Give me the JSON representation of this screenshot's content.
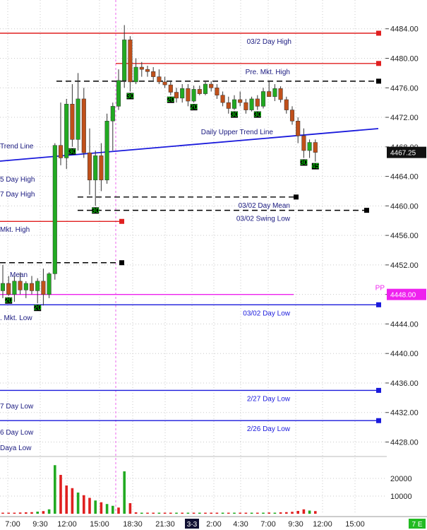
{
  "chart_data": {
    "type": "candlestick",
    "price_axis": {
      "ticks": [
        4484,
        4480,
        4476,
        4472,
        4468,
        4464,
        4460,
        4456,
        4452,
        4448,
        4444,
        4440,
        4436,
        4432,
        4428
      ],
      "tick_labels": [
        "4484.00",
        "4480.00",
        "4476.00",
        "4472.00",
        "4468.00",
        "4464.00",
        "4460.00",
        "4456.00",
        "4452.00",
        "4448.00",
        "4444.00",
        "4440.00",
        "4436.00",
        "4432.00",
        "4428.00"
      ],
      "ylim": [
        4426.9,
        4487.9
      ],
      "last_price_label": "4467.25",
      "last_price": 4467.25,
      "pivot_price_label": "4448.00",
      "pivot_price": 4448.0
    },
    "volume_axis": {
      "ticks": [
        20000,
        10000
      ],
      "tick_labels": [
        "20000",
        "10000"
      ]
    },
    "time_axis": {
      "labels": [
        "7:00",
        "9:30",
        "12:00",
        "15:00",
        "18:30",
        "21:30",
        "3-3",
        "2:00",
        "4:30",
        "7:00",
        "9:30",
        "12:00",
        "15:00"
      ],
      "session_divider_label": "3-3",
      "corner_label": "7 E"
    },
    "levels": [
      {
        "label": "03/2 Day High",
        "price": 4483.4,
        "color": "#e02020",
        "style": "solid"
      },
      {
        "label": "Pre. Mkt. High",
        "price": 4479.3,
        "color": "#e02020",
        "style": "solid"
      },
      {
        "label": "",
        "price": 4476.9,
        "color": "#000000",
        "style": "dashed"
      },
      {
        "label": "03/02 Day Mean",
        "price": 4461.2,
        "color": "#000000",
        "style": "dashed"
      },
      {
        "label": "03/02 Swing Low",
        "price": 4459.4,
        "color": "#000000",
        "style": "dashed"
      },
      {
        "label": "Mkt. High",
        "price": 4457.9,
        "color": "#e02020",
        "style": "solid"
      },
      {
        "label": "",
        "price": 4452.3,
        "color": "#000000",
        "style": "dashed"
      },
      {
        "label": "PP",
        "price": 4448.0,
        "color": "#ee22ee",
        "style": "solid"
      },
      {
        "label": "03/02 Day Low",
        "price": 4446.6,
        "color": "#1a1adc",
        "style": "solid"
      },
      {
        "label": "2/27 Day Low",
        "price": 4435.0,
        "color": "#1a1adc",
        "style": "solid"
      },
      {
        "label": "2/26 Day Low",
        "price": 4430.9,
        "color": "#1a1adc",
        "style": "solid"
      }
    ],
    "left_labels": [
      "Trend Line",
      "5 Day High",
      "7 Day High",
      "Mkt. High",
      "Mean",
      ". Mkt. Low",
      "7 Day Low",
      "6 Day Low",
      "Daya Low"
    ],
    "trend_line": {
      "label": "Daily Upper Trend Line",
      "color": "#1a1adc"
    },
    "candles": [
      {
        "o": 4448.5,
        "h": 4452.0,
        "l": 4447.5,
        "c": 4449.5
      },
      {
        "o": 4449.5,
        "h": 4450.5,
        "l": 4447.8,
        "c": 4448.0
      },
      {
        "o": 4448.0,
        "h": 4450.5,
        "l": 4447.0,
        "c": 4449.8
      },
      {
        "o": 4449.8,
        "h": 4451.0,
        "l": 4448.0,
        "c": 4448.6
      },
      {
        "o": 4448.6,
        "h": 4449.8,
        "l": 4447.5,
        "c": 4449.5
      },
      {
        "o": 4449.5,
        "h": 4450.5,
        "l": 4448.0,
        "c": 4448.5
      },
      {
        "o": 4448.5,
        "h": 4450.2,
        "l": 4446.8,
        "c": 4449.8
      },
      {
        "o": 4449.8,
        "h": 4451.5,
        "l": 4446.5,
        "c": 4448.0
      },
      {
        "o": 4448.0,
        "h": 4451.0,
        "l": 4447.5,
        "c": 4450.8
      },
      {
        "o": 4450.8,
        "h": 4468.5,
        "l": 4450.0,
        "c": 4468.2
      },
      {
        "o": 4468.2,
        "h": 4474.0,
        "l": 4465.5,
        "c": 4466.5
      },
      {
        "o": 4466.5,
        "h": 4474.5,
        "l": 4465.0,
        "c": 4473.8
      },
      {
        "o": 4473.8,
        "h": 4476.5,
        "l": 4468.0,
        "c": 4469.0
      },
      {
        "o": 4469.0,
        "h": 4478.0,
        "l": 4467.5,
        "c": 4474.5
      },
      {
        "o": 4474.5,
        "h": 4476.0,
        "l": 4466.5,
        "c": 4467.2
      },
      {
        "o": 4467.2,
        "h": 4470.5,
        "l": 4461.5,
        "c": 4463.5
      },
      {
        "o": 4463.5,
        "h": 4467.5,
        "l": 4460.0,
        "c": 4466.8
      },
      {
        "o": 4466.8,
        "h": 4468.5,
        "l": 4462.0,
        "c": 4463.5
      },
      {
        "o": 4463.5,
        "h": 4472.5,
        "l": 4463.0,
        "c": 4471.5
      },
      {
        "o": 4471.5,
        "h": 4474.0,
        "l": 4467.5,
        "c": 4473.5
      },
      {
        "o": 4473.5,
        "h": 4478.5,
        "l": 4473.0,
        "c": 4477.0
      },
      {
        "o": 4477.0,
        "h": 4484.5,
        "l": 4476.0,
        "c": 4482.5
      },
      {
        "o": 4482.5,
        "h": 4483.0,
        "l": 4475.5,
        "c": 4476.8
      },
      {
        "o": 4476.8,
        "h": 4480.0,
        "l": 4476.5,
        "c": 4478.8
      },
      {
        "o": 4478.8,
        "h": 4479.5,
        "l": 4477.5,
        "c": 4478.5
      },
      {
        "o": 4478.5,
        "h": 4479.0,
        "l": 4477.5,
        "c": 4478.2
      },
      {
        "o": 4478.2,
        "h": 4478.8,
        "l": 4477.0,
        "c": 4477.5
      },
      {
        "o": 4477.5,
        "h": 4478.5,
        "l": 4476.5,
        "c": 4476.8
      },
      {
        "o": 4476.8,
        "h": 4477.5,
        "l": 4476.0,
        "c": 4476.4
      },
      {
        "o": 4476.4,
        "h": 4477.0,
        "l": 4475.0,
        "c": 4475.4
      },
      {
        "o": 4475.4,
        "h": 4476.0,
        "l": 4474.0,
        "c": 4474.6
      },
      {
        "o": 4474.6,
        "h": 4476.5,
        "l": 4474.0,
        "c": 4475.9
      },
      {
        "o": 4475.9,
        "h": 4476.5,
        "l": 4473.5,
        "c": 4474.2
      },
      {
        "o": 4474.2,
        "h": 4476.3,
        "l": 4474.0,
        "c": 4475.8
      },
      {
        "o": 4475.8,
        "h": 4476.3,
        "l": 4475.0,
        "c": 4475.2
      },
      {
        "o": 4475.2,
        "h": 4476.8,
        "l": 4475.0,
        "c": 4476.5
      },
      {
        "o": 4476.5,
        "h": 4476.9,
        "l": 4475.5,
        "c": 4476.0
      },
      {
        "o": 4476.0,
        "h": 4476.5,
        "l": 4474.5,
        "c": 4475.0
      },
      {
        "o": 4475.0,
        "h": 4475.5,
        "l": 4473.5,
        "c": 4474.0
      },
      {
        "o": 4474.0,
        "h": 4474.8,
        "l": 4472.5,
        "c": 4473.2
      },
      {
        "o": 4473.2,
        "h": 4475.0,
        "l": 4473.0,
        "c": 4474.4
      },
      {
        "o": 4474.4,
        "h": 4475.5,
        "l": 4473.5,
        "c": 4474.0
      },
      {
        "o": 4474.0,
        "h": 4474.5,
        "l": 4472.5,
        "c": 4473.0
      },
      {
        "o": 4473.0,
        "h": 4474.8,
        "l": 4472.8,
        "c": 4474.5
      },
      {
        "o": 4474.5,
        "h": 4475.0,
        "l": 4473.0,
        "c": 4473.5
      },
      {
        "o": 4473.5,
        "h": 4476.0,
        "l": 4473.2,
        "c": 4475.5
      },
      {
        "o": 4475.5,
        "h": 4477.0,
        "l": 4474.8,
        "c": 4474.8
      },
      {
        "o": 4474.8,
        "h": 4476.5,
        "l": 4474.2,
        "c": 4475.9
      },
      {
        "o": 4475.9,
        "h": 4476.2,
        "l": 4474.0,
        "c": 4474.4
      },
      {
        "o": 4474.4,
        "h": 4474.8,
        "l": 4472.5,
        "c": 4473.0
      },
      {
        "o": 4473.0,
        "h": 4473.5,
        "l": 4471.0,
        "c": 4471.5
      },
      {
        "o": 4471.5,
        "h": 4472.0,
        "l": 4468.5,
        "c": 4469.5
      },
      {
        "o": 4469.5,
        "h": 4470.5,
        "l": 4466.5,
        "c": 4467.5
      },
      {
        "o": 4467.5,
        "h": 4469.0,
        "l": 4466.5,
        "c": 4468.6
      },
      {
        "o": 4468.6,
        "h": 4469.0,
        "l": 4466.0,
        "c": 4467.25
      }
    ],
    "volume": [
      {
        "v": 500,
        "dir": "down"
      },
      {
        "v": 400,
        "dir": "down"
      },
      {
        "v": 600,
        "dir": "down"
      },
      {
        "v": 700,
        "dir": "down"
      },
      {
        "v": 800,
        "dir": "down"
      },
      {
        "v": 900,
        "dir": "down"
      },
      {
        "v": 1200,
        "dir": "up"
      },
      {
        "v": 1500,
        "dir": "down"
      },
      {
        "v": 2500,
        "dir": "up"
      },
      {
        "v": 27500,
        "dir": "up"
      },
      {
        "v": 22000,
        "dir": "down"
      },
      {
        "v": 16000,
        "dir": "down"
      },
      {
        "v": 14500,
        "dir": "down"
      },
      {
        "v": 12000,
        "dir": "up"
      },
      {
        "v": 10500,
        "dir": "down"
      },
      {
        "v": 9000,
        "dir": "down"
      },
      {
        "v": 7500,
        "dir": "up"
      },
      {
        "v": 6500,
        "dir": "down"
      },
      {
        "v": 5500,
        "dir": "up"
      },
      {
        "v": 4500,
        "dir": "up"
      },
      {
        "v": 3500,
        "dir": "down"
      },
      {
        "v": 24000,
        "dir": "up"
      },
      {
        "v": 6000,
        "dir": "down"
      },
      {
        "v": 800,
        "dir": "down"
      },
      {
        "v": 500,
        "dir": "up"
      },
      {
        "v": 300,
        "dir": "down"
      },
      {
        "v": 300,
        "dir": "down"
      },
      {
        "v": 250,
        "dir": "up"
      },
      {
        "v": 200,
        "dir": "down"
      },
      {
        "v": 250,
        "dir": "down"
      },
      {
        "v": 200,
        "dir": "up"
      },
      {
        "v": 250,
        "dir": "down"
      },
      {
        "v": 300,
        "dir": "up"
      },
      {
        "v": 250,
        "dir": "down"
      },
      {
        "v": 300,
        "dir": "up"
      },
      {
        "v": 250,
        "dir": "down"
      },
      {
        "v": 300,
        "dir": "down"
      },
      {
        "v": 250,
        "dir": "down"
      },
      {
        "v": 300,
        "dir": "up"
      },
      {
        "v": 350,
        "dir": "down"
      },
      {
        "v": 300,
        "dir": "up"
      },
      {
        "v": 350,
        "dir": "down"
      },
      {
        "v": 400,
        "dir": "down"
      },
      {
        "v": 450,
        "dir": "up"
      },
      {
        "v": 500,
        "dir": "down"
      },
      {
        "v": 600,
        "dir": "up"
      },
      {
        "v": 700,
        "dir": "down"
      },
      {
        "v": 600,
        "dir": "up"
      },
      {
        "v": 800,
        "dir": "down"
      },
      {
        "v": 900,
        "dir": "down"
      },
      {
        "v": 1100,
        "dir": "down"
      },
      {
        "v": 1600,
        "dir": "down"
      },
      {
        "v": 2500,
        "dir": "down"
      },
      {
        "v": 1800,
        "dir": "up"
      },
      {
        "v": 1500,
        "dir": "down"
      }
    ],
    "bar_markers": [
      {
        "bar": 1,
        "text": "20"
      },
      {
        "bar": 6,
        "text": "20"
      },
      {
        "bar": 12,
        "text": "30"
      },
      {
        "bar": 16,
        "text": "30"
      },
      {
        "bar": 22,
        "text": "30"
      },
      {
        "bar": 29,
        "text": "20"
      },
      {
        "bar": 33,
        "text": "20"
      },
      {
        "bar": 40,
        "text": "30"
      },
      {
        "bar": 44,
        "text": "30"
      },
      {
        "bar": 52,
        "text": "30"
      },
      {
        "bar": 54,
        "text": "45"
      }
    ]
  }
}
